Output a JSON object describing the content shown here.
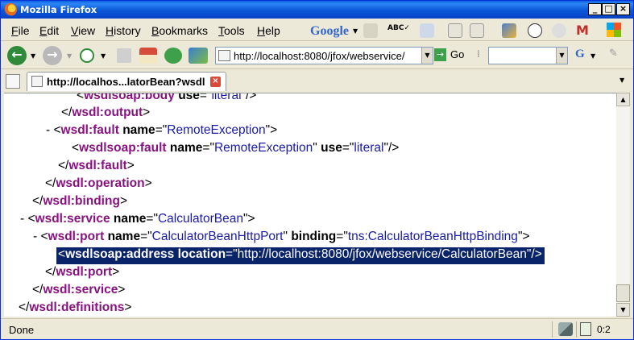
{
  "window": {
    "title": "Mozilla Firefox"
  },
  "menubar": {
    "items": [
      {
        "label": "File",
        "ul": "F",
        "rest": "ile"
      },
      {
        "label": "Edit",
        "ul": "E",
        "rest": "dit"
      },
      {
        "label": "View",
        "ul": "V",
        "rest": "iew"
      },
      {
        "label": "History",
        "ul": "H",
        "rest": "istory"
      },
      {
        "label": "Bookmarks",
        "ul": "B",
        "rest": "ookmarks"
      },
      {
        "label": "Tools",
        "ul": "T",
        "rest": "ools"
      },
      {
        "label": "Help",
        "ul": "H",
        "rest": "elp"
      }
    ],
    "google_label": "Google"
  },
  "navbar": {
    "url": "http://localhost:8080/jfox/webservice/",
    "go_label": "Go",
    "search_placeholder": ""
  },
  "tab": {
    "title": "http://localhos...latorBean?wsdl"
  },
  "xml_lines": [
    [
      "<",
      "wsdlsoap:body",
      " ",
      "use",
      "=\"",
      "literal",
      "\"/>"
    ],
    [
      "</",
      "wsdl:output",
      ">"
    ],
    [
      "- <",
      "wsdl:fault",
      " ",
      "name",
      "=\"",
      "RemoteException",
      "\">"
    ],
    [
      "<",
      "wsdlsoap:fault",
      " ",
      "name",
      "=\"",
      "RemoteException",
      "\" ",
      "use",
      "=\"",
      "literal",
      "\"/>"
    ],
    [
      "</",
      "wsdl:fault",
      ">"
    ],
    [
      "</",
      "wsdl:operation",
      ">"
    ],
    [
      "</",
      "wsdl:binding",
      ">"
    ],
    [
      "- <",
      "wsdl:service",
      " ",
      "name",
      "=\"",
      "CalculatorBean",
      "\">"
    ],
    [
      "- <",
      "wsdl:port",
      " ",
      "name",
      "=\"",
      "CalculatorBeanHttpPort",
      "\" ",
      "binding",
      "=\"",
      "tns:CalculatorBeanHttpBinding",
      "\">"
    ],
    [
      "<",
      "wsdlsoap:address",
      " ",
      "location",
      "=\"",
      "http://localhost:8080/jfox/webservice/CalculatorBean",
      "\"/>"
    ],
    [
      "</",
      "wsdl:port",
      ">"
    ],
    [
      "</",
      "wsdl:service",
      ">"
    ],
    [
      "</",
      "wsdl:definitions",
      ">"
    ]
  ],
  "status": {
    "text": "Done",
    "counter": "0:2"
  },
  "icons": {
    "app": "firefox-icon",
    "back": "back-arrow-icon",
    "forward": "forward-arrow-icon",
    "reload": "reload-icon",
    "stop": "stop-icon",
    "home": "home-icon"
  }
}
